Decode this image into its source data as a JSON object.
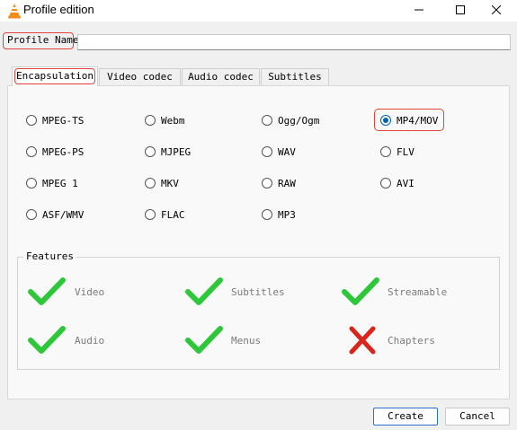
{
  "window": {
    "title": "Profile edition"
  },
  "profile": {
    "label": "Profile Name",
    "value": ""
  },
  "tabs": [
    {
      "label": "Encapsulation",
      "active": true
    },
    {
      "label": "Video codec",
      "active": false
    },
    {
      "label": "Audio codec",
      "active": false
    },
    {
      "label": "Subtitles",
      "active": false
    }
  ],
  "encapsulation": {
    "selected": "MP4/MOV",
    "options": [
      "MPEG-TS",
      "Webm",
      "Ogg/Ogm",
      "MP4/MOV",
      "MPEG-PS",
      "MJPEG",
      "WAV",
      "FLV",
      "MPEG 1",
      "MKV",
      "RAW",
      "AVI",
      "ASF/WMV",
      "FLAC",
      "MP3"
    ]
  },
  "features": {
    "title": "Features",
    "items": [
      {
        "label": "Video",
        "supported": true
      },
      {
        "label": "Subtitles",
        "supported": true
      },
      {
        "label": "Streamable",
        "supported": true
      },
      {
        "label": "Audio",
        "supported": true
      },
      {
        "label": "Menus",
        "supported": true
      },
      {
        "label": "Chapters",
        "supported": false
      }
    ]
  },
  "buttons": {
    "create": "Create",
    "cancel": "Cancel"
  },
  "colors": {
    "check": "#2ec73a",
    "cross": "#d9251c",
    "accent": "#0063b1",
    "highlight": "#e0443a"
  }
}
